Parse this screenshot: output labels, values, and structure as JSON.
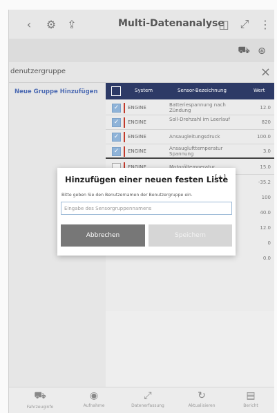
{
  "app": {
    "title": "Multi-Datenanalyse"
  },
  "group_bar": {
    "label": "denutzergruppe",
    "close": "×"
  },
  "left_panel": {
    "new_group": "Neue Gruppe Hinzufügen"
  },
  "table": {
    "headers": {
      "system": "System",
      "sensor": "Sensor-Bezeichnung",
      "value": "Wert"
    },
    "rows": [
      {
        "checked": true,
        "system": "ENGINE",
        "sensor": "Batteriespannung nach Zündung",
        "value": "12.0"
      },
      {
        "checked": true,
        "system": "ENGINE",
        "sensor": "Soll-Drehzahl im Leerlauf",
        "value": "820"
      },
      {
        "checked": true,
        "system": "ENGINE",
        "sensor": "Ansaugleitungsdruck",
        "value": "100.0"
      },
      {
        "checked": true,
        "system": "ENGINE",
        "sensor": "Ansauglufttemperatur Spannung",
        "value": "3.0"
      },
      {
        "checked": false,
        "system": "ENGINE",
        "sensor": "Motoröltemperatur",
        "value": "15.0"
      }
    ],
    "extra_values": [
      "-35.2",
      "100",
      "40.0",
      "12.0",
      "0",
      "0.0"
    ]
  },
  "bottom_tabs": [
    {
      "icon": "car-icon",
      "label": "Fahrzeuginfo"
    },
    {
      "icon": "record-icon",
      "label": "Aufnahme"
    },
    {
      "icon": "expand-icon",
      "label": "Datenerfassung"
    },
    {
      "icon": "refresh-icon",
      "label": "Aktualisieren"
    },
    {
      "icon": "report-icon",
      "label": "Bericht"
    }
  ],
  "modal": {
    "title": "Hinzufügen einer neuen festen Liste",
    "subtitle": "Bitte geben Sie den Benutzernamen der Benutzergruppe ein.",
    "input_placeholder": "Eingabe des Sensorgruppennamens",
    "input_value": "",
    "cancel_label": "Abbrechen",
    "save_label": "Speichern"
  },
  "colors": {
    "header_bg": "#2d3a66",
    "system_marker": "#c0392b",
    "checkbox_checked": "#8fb3d8",
    "cancel_button": "#777777",
    "save_button_disabled": "#d6d6d6",
    "link_blue": "#4d6bb3"
  }
}
